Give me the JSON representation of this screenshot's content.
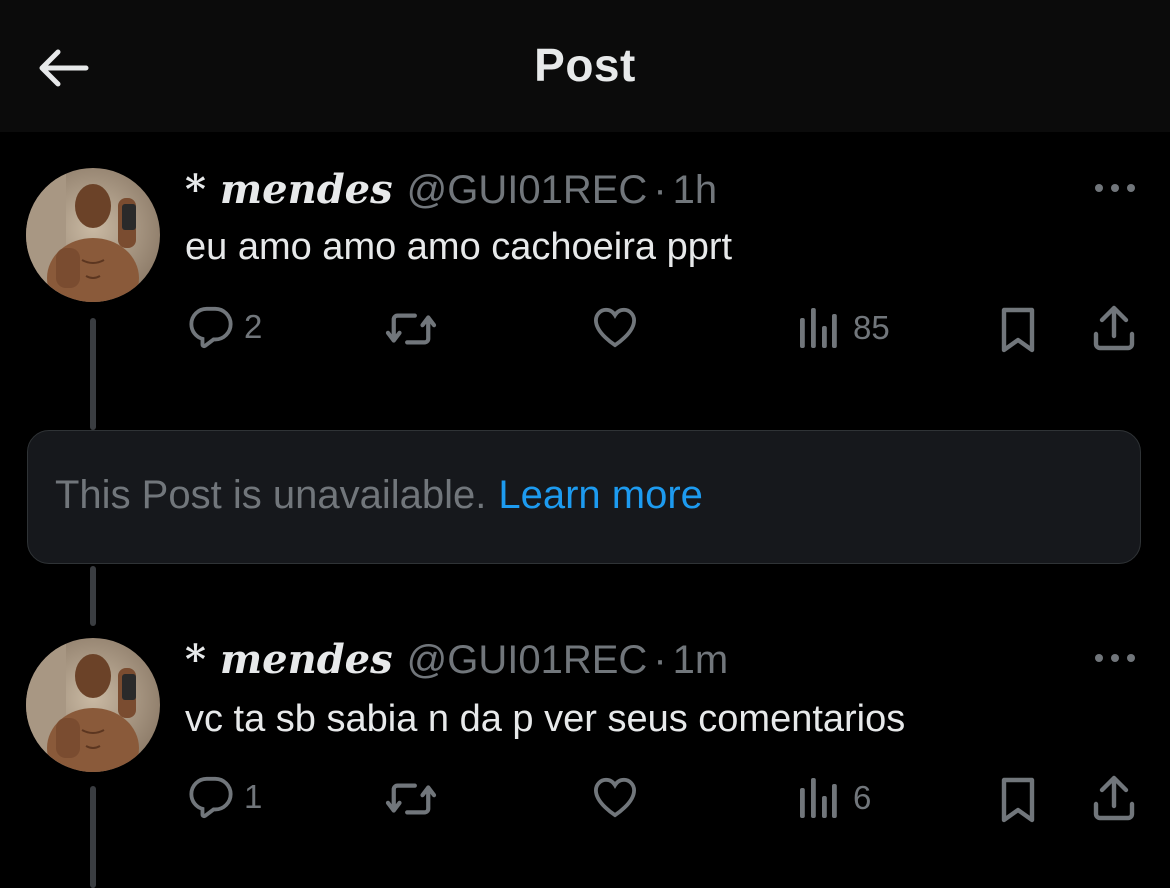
{
  "header": {
    "title": "Post",
    "back_icon": "arrow-left-icon"
  },
  "posts": [
    {
      "display_name": "* mendes",
      "handle": "@GUI01REC",
      "separator": "·",
      "time": "1h",
      "text": "eu amo amo amo cachoeira pprt",
      "replies": "2",
      "reposts": "",
      "likes": "",
      "views": "85"
    },
    {
      "display_name": "* mendes",
      "handle": "@GUI01REC",
      "separator": "·",
      "time": "1m",
      "text": "vc ta sb sabia n da p ver seus comentarios",
      "replies": "1",
      "reposts": "",
      "likes": "",
      "views": "6"
    }
  ],
  "unavailable": {
    "message": "This Post is unavailable.",
    "link": "Learn more"
  },
  "colors": {
    "background": "#000000",
    "header_bg": "#0b0b0b",
    "primary_text": "#e7e9ea",
    "secondary_text": "#71767b",
    "link": "#1d9bf0",
    "card_bg": "#16181c",
    "thread_line": "#3a3d41"
  }
}
